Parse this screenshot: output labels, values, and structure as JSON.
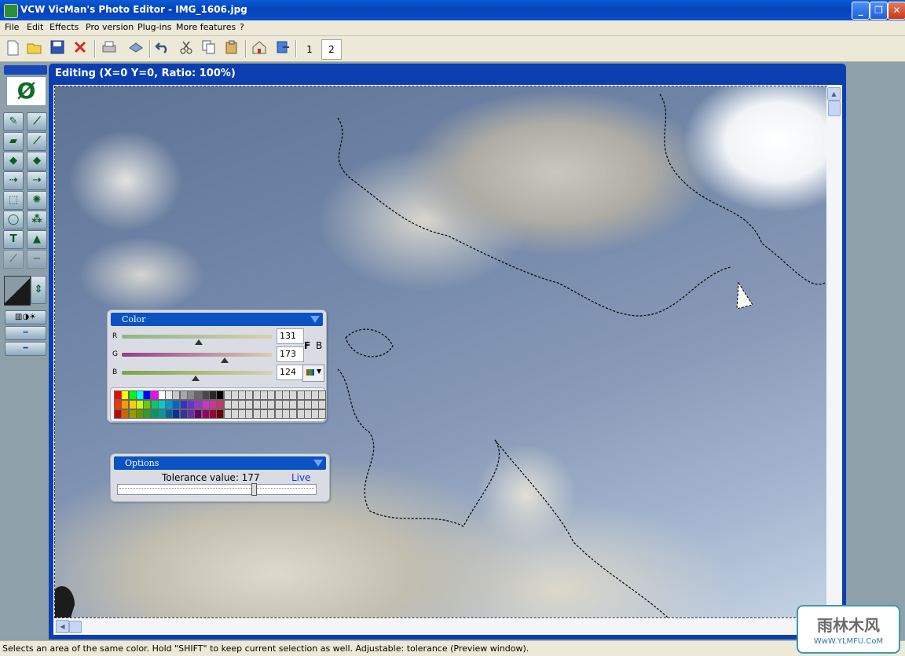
{
  "window": {
    "title": "VCW VicMan's Photo Editor - IMG_1606.jpg",
    "minimize_glyph": "_",
    "restore_glyph": "❐",
    "close_glyph": "✕"
  },
  "menu": [
    "File",
    "Edit",
    "Effects",
    "Pro version",
    "Plug-ins",
    "More features",
    "?"
  ],
  "toolbar": {
    "icons": [
      "new-icon",
      "open-icon",
      "save-icon",
      "delete-icon",
      "print-icon",
      "scan-icon",
      "undo-icon",
      "cut-icon",
      "copy-icon",
      "paste-icon",
      "home-icon",
      "export-icon"
    ],
    "tabs": [
      "1",
      "2"
    ],
    "active_tab": "2"
  },
  "edit_window": {
    "title": "Editing (X=0 Y=0, Ratio: 100%)"
  },
  "tools": {
    "logo_glyph": "Ø",
    "tool_icons": [
      "pencil-icon",
      "brush-icon",
      "eraser-icon",
      "eyedropper-icon",
      "fill-icon",
      "fill-gradient-icon",
      "resize-icon",
      "crop-icon",
      "rect-select-icon",
      "magic-wand-icon",
      "lasso-icon",
      "clone-icon",
      "text-icon",
      "stamp-icon",
      "line-icon",
      "smudge-icon"
    ],
    "text_glyph": "T"
  },
  "color_panel": {
    "title": "Color",
    "labels": {
      "r": "R",
      "g": "G",
      "b": "B"
    },
    "values": {
      "r": "131",
      "g": "173",
      "b": "124"
    },
    "fb_label": {
      "f": "F",
      "b": "B"
    },
    "slider_levels": {
      "r": 0.51,
      "g": 0.68,
      "b": 0.49
    },
    "colors": {
      "r_track": "#8eb48a",
      "g_track": "#9a3a8e",
      "b_track": "#7ea24b"
    }
  },
  "palette": {
    "rows": [
      [
        "#ff0000",
        "#ffff00",
        "#00ff00",
        "#00ffff",
        "#0000ff",
        "#ff00ff",
        "#ffffff",
        "#e8e8e8",
        "#c8c8c8",
        "#a8a8a8",
        "#888888",
        "#686868",
        "#484848",
        "#282828",
        "#000000",
        "#d8d8d8",
        "#d8d8d8",
        "#d8d8d8",
        "#d8d8d8",
        "#d8d8d8",
        "#d8d8d8",
        "#d8d8d8",
        "#d8d8d8",
        "#d8d8d8",
        "#d8d8d8",
        "#d8d8d8",
        "#d8d8d8",
        "#d8d8d8",
        "#d8d8d8"
      ],
      [
        "#ff3300",
        "#ff9900",
        "#ffcc00",
        "#ccff00",
        "#66cc00",
        "#00cc66",
        "#00cccc",
        "#0099cc",
        "#0066cc",
        "#3333cc",
        "#6633cc",
        "#9933cc",
        "#cc33cc",
        "#cc3399",
        "#cc3366",
        "#d8d8d8",
        "#d8d8d8",
        "#d8d8d8",
        "#d8d8d8",
        "#d8d8d8",
        "#d8d8d8",
        "#d8d8d8",
        "#d8d8d8",
        "#d8d8d8",
        "#d8d8d8",
        "#d8d8d8",
        "#d8d8d8",
        "#d8d8d8",
        "#d8d8d8"
      ],
      [
        "#cc0000",
        "#cc6600",
        "#999900",
        "#669900",
        "#339933",
        "#009966",
        "#009999",
        "#006699",
        "#003399",
        "#333399",
        "#663399",
        "#660066",
        "#990066",
        "#990033",
        "#660000",
        "#d8d8d8",
        "#d8d8d8",
        "#d8d8d8",
        "#d8d8d8",
        "#d8d8d8",
        "#d8d8d8",
        "#d8d8d8",
        "#d8d8d8",
        "#d8d8d8",
        "#d8d8d8",
        "#d8d8d8",
        "#d8d8d8",
        "#d8d8d8",
        "#d8d8d8"
      ]
    ]
  },
  "options_panel": {
    "title": "Options",
    "tolerance_label": "Tolerance value: 177",
    "live_label": "Live",
    "tolerance_level": 0.69
  },
  "statusbar": {
    "text": "Selects an area of the same color. Hold \"SHIFT\" to keep current selection as well. Adjustable: tolerance (Preview window)."
  },
  "watermark": {
    "title": "雨林木风",
    "url": "WwW.YLMFU.CoM"
  }
}
